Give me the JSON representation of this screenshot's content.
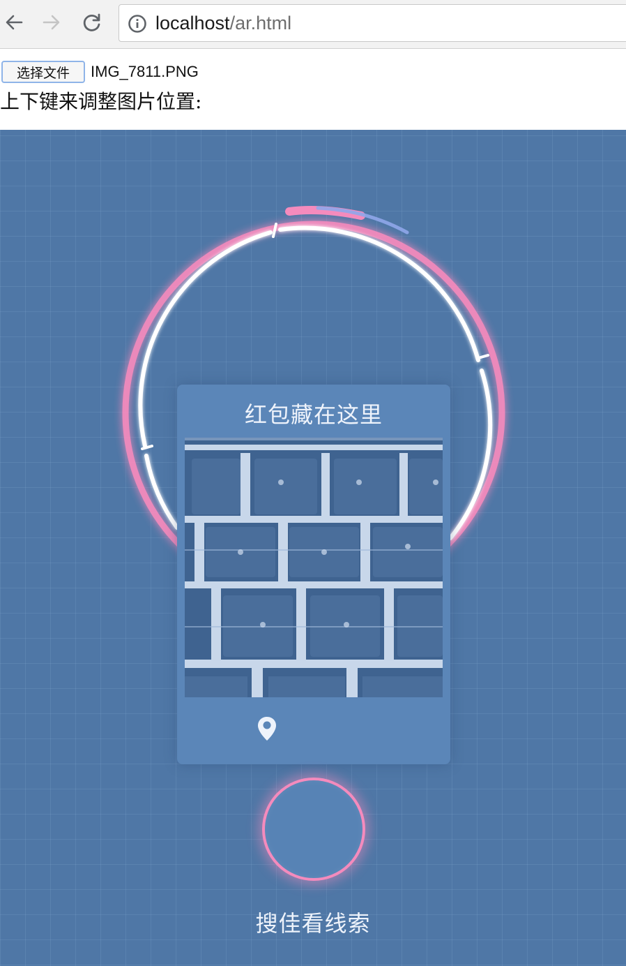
{
  "browser": {
    "url_host": "localhost",
    "url_path": "/ar.html",
    "icons": [
      "back-arrow-icon",
      "forward-arrow-icon",
      "reload-icon",
      "info-icon"
    ]
  },
  "page": {
    "file_button_label": "选择文件",
    "file_name": "IMG_7811.PNG",
    "hint": "上下键来调整图片位置:"
  },
  "ar": {
    "card_title": "红包藏在这里",
    "location_icon": "location-pin-icon",
    "shutter_label": "搜佳看线索",
    "colors": {
      "background": "#4f77a6",
      "ring_pink": "#f48bbd",
      "ring_white": "#ffffff",
      "card": "#5b86b8"
    }
  }
}
